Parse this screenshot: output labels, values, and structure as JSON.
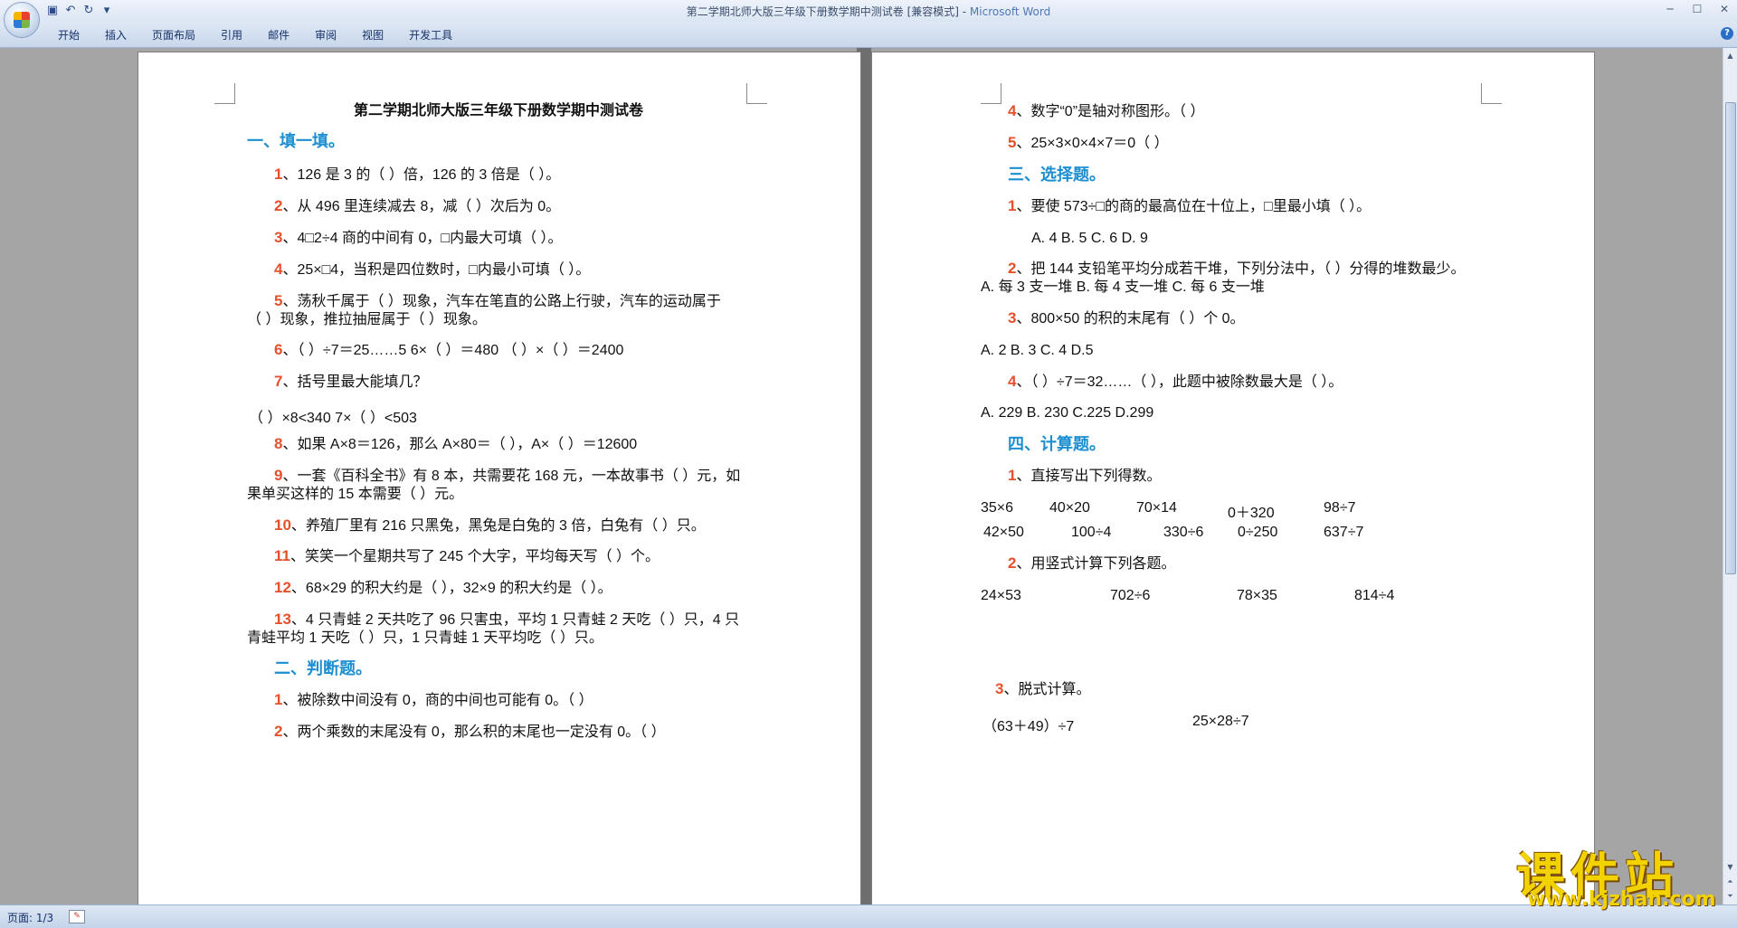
{
  "window": {
    "title": "第二学期北师大版三年级下册数学期中测试卷 [兼容模式] - ",
    "app_name": "Microsoft Word"
  },
  "ribbon_tabs": [
    "开始",
    "插入",
    "页面布局",
    "引用",
    "邮件",
    "审阅",
    "视图",
    "开发工具"
  ],
  "status": {
    "page": "页面: 1/3"
  },
  "watermark": {
    "title": "课件站",
    "url": "www.kjzhan.com"
  },
  "left_page": {
    "title": "第二学期北师大版三年级下册数学期中测试卷",
    "section1": "一、填一填。",
    "q1": {
      "num": "1",
      "text": "、126 是 3 的（  ）倍，126 的 3 倍是（  ）。"
    },
    "q2": {
      "num": "2",
      "text": "、从 496 里连续减去 8，减（  ）次后为 0。"
    },
    "q3": {
      "num": "3",
      "text": "、4□2÷4 商的中间有 0，□内最大可填（  ）。"
    },
    "q4": {
      "num": "4",
      "text": "、25×□4，当积是四位数时，□内最小可填（  ）。"
    },
    "q5": {
      "num": "5",
      "text": "、荡秋千属于（  ）现象，汽车在笔直的公路上行驶，汽车的运动属于"
    },
    "q5b": "（  ）现象，推拉抽屉属于（  ）现象。",
    "q6": {
      "num": "6",
      "text": "、（  ）÷7＝25……5 6×（  ）＝480  （  ）×（  ）＝2400"
    },
    "q7": {
      "num": "7",
      "text": "、括号里最大能填几？"
    },
    "q7b": "（  ）×8<340     7×（  ）<503",
    "q8": {
      "num": "8",
      "text": "、如果 A×8＝126，那么 A×80＝（  ），A×（  ）＝12600"
    },
    "q9": {
      "num": "9",
      "text": "、一套《百科全书》有 8 本，共需要花 168 元，一本故事书（  ）元，如"
    },
    "q9b": "果单买这样的 15 本需要（  ）元。",
    "q10": {
      "num": "10",
      "text": "、养殖厂里有 216 只黑兔，黑兔是白兔的 3 倍，白兔有（  ）只。"
    },
    "q11": {
      "num": "11",
      "text": "、笑笑一个星期共写了 245 个大字，平均每天写（  ）个。"
    },
    "q12": {
      "num": "12",
      "text": "、68×29 的积大约是（  ），32×9 的积大约是（  ）。"
    },
    "q13": {
      "num": "13",
      "text": "、4 只青蛙 2 天共吃了 96 只害虫，平均 1 只青蛙 2 天吃（  ）只，4 只"
    },
    "q13b": "青蛙平均 1 天吃（  ）只，1 只青蛙 1 天平均吃（  ）只。",
    "section2": "二、判断题。",
    "j1": {
      "num": "1",
      "text": "、被除数中间没有 0，商的中间也可能有 0。（  ）"
    },
    "j2": {
      "num": "2",
      "text": "、两个乘数的末尾没有 0，那么积的末尾也一定没有 0。（  ）"
    }
  },
  "right_page": {
    "j4": {
      "num": "4",
      "text": "、数字“0”是轴对称图形。（  ）"
    },
    "j5": {
      "num": "5",
      "text": "、25×3×0×4×7＝0（  ）"
    },
    "section3": "三、选择题。",
    "c1": {
      "num": "1",
      "text": "、要使 573÷□的商的最高位在十位上，□里最小填（  ）。"
    },
    "c1_opts": "A. 4    B. 5    C. 6      D. 9",
    "c2": {
      "num": "2",
      "text": "、把 144 支铅笔平均分成若干堆，下列分法中，（  ）分得的堆数最少。"
    },
    "c2_opts": "A. 每 3 支一堆      B. 每 4 支一堆     C. 每 6 支一堆",
    "c3": {
      "num": "3",
      "text": "、800×50 的积的末尾有（  ）个 0。"
    },
    "c3_opts": "A. 2   B. 3  C. 4   D.5",
    "c4": {
      "num": "4",
      "text": "、（  ）÷7＝32……（  ），此题中被除数最大是（  ）。"
    },
    "c4_opts": "A. 229     B. 230     C.225       D.299",
    "section4": "四、计算题。",
    "k1": {
      "num": "1",
      "text": "、直接写出下列得数。"
    },
    "k1_row1": [
      "35×6",
      "40×20",
      "70×14",
      "0＋320",
      "98÷7"
    ],
    "k1_row2": [
      "42×50",
      "100÷4",
      "330÷6",
      "0÷250",
      "637÷7"
    ],
    "k2": {
      "num": "2",
      "text": "、用竖式计算下列各题。"
    },
    "k2_row": [
      "24×53",
      "702÷6",
      "78×35",
      "814÷4"
    ],
    "k3": {
      "num": "3",
      "text": "、脱式计算。"
    },
    "k3_row": [
      "（63＋49）÷7",
      "25×28÷7"
    ]
  }
}
